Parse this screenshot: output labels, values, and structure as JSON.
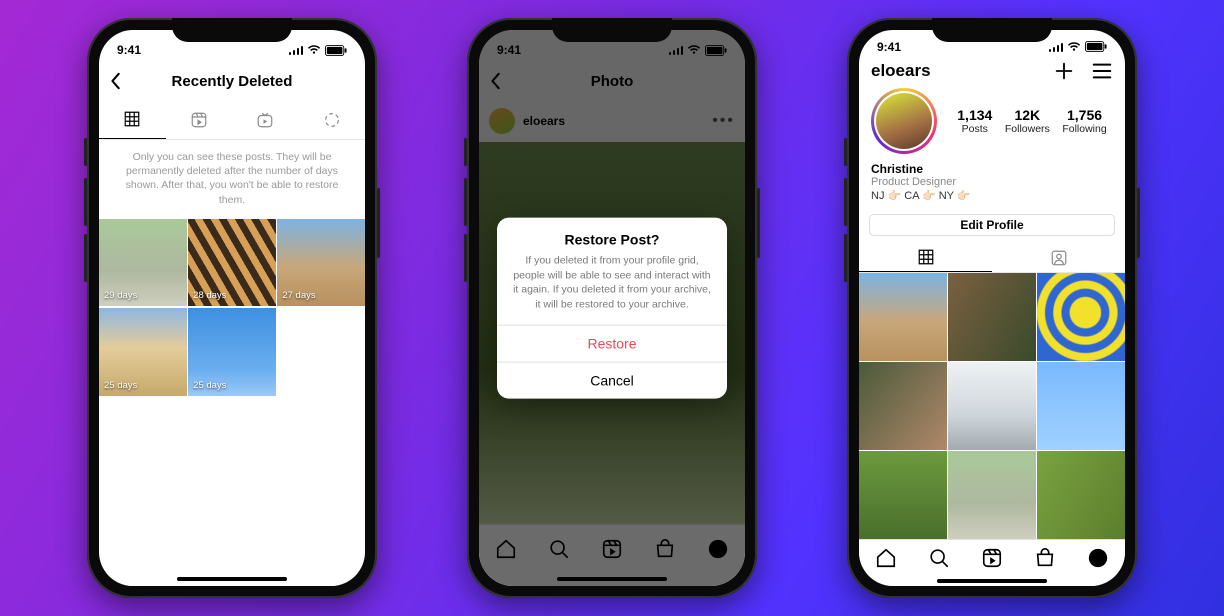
{
  "status": {
    "time": "9:41"
  },
  "phone1": {
    "title": "Recently Deleted",
    "info": "Only you can see these posts. They will be permanently deleted after the number of days shown. After that, you won't be able to restore them.",
    "thumbs": [
      {
        "label": "29 days"
      },
      {
        "label": "28 days"
      },
      {
        "label": "27 days"
      },
      {
        "label": "25 days"
      },
      {
        "label": "25 days"
      }
    ]
  },
  "phone2": {
    "title": "Photo",
    "username": "eloears",
    "alert": {
      "title": "Restore Post?",
      "body": "If you deleted it from your profile grid, people will be able to see and interact with it again. If you deleted it from your archive, it will be restored to your archive.",
      "restore": "Restore",
      "cancel": "Cancel"
    }
  },
  "phone3": {
    "username": "eloears",
    "stats": {
      "posts": {
        "num": "1,134",
        "label": "Posts"
      },
      "followers": {
        "num": "12K",
        "label": "Followers"
      },
      "following": {
        "num": "1,756",
        "label": "Following"
      }
    },
    "bio": {
      "name": "Christine",
      "role": "Product Designer",
      "location": "NJ 👉🏻 CA 👉🏻 NY 👉🏻"
    },
    "edit_profile": "Edit Profile"
  }
}
